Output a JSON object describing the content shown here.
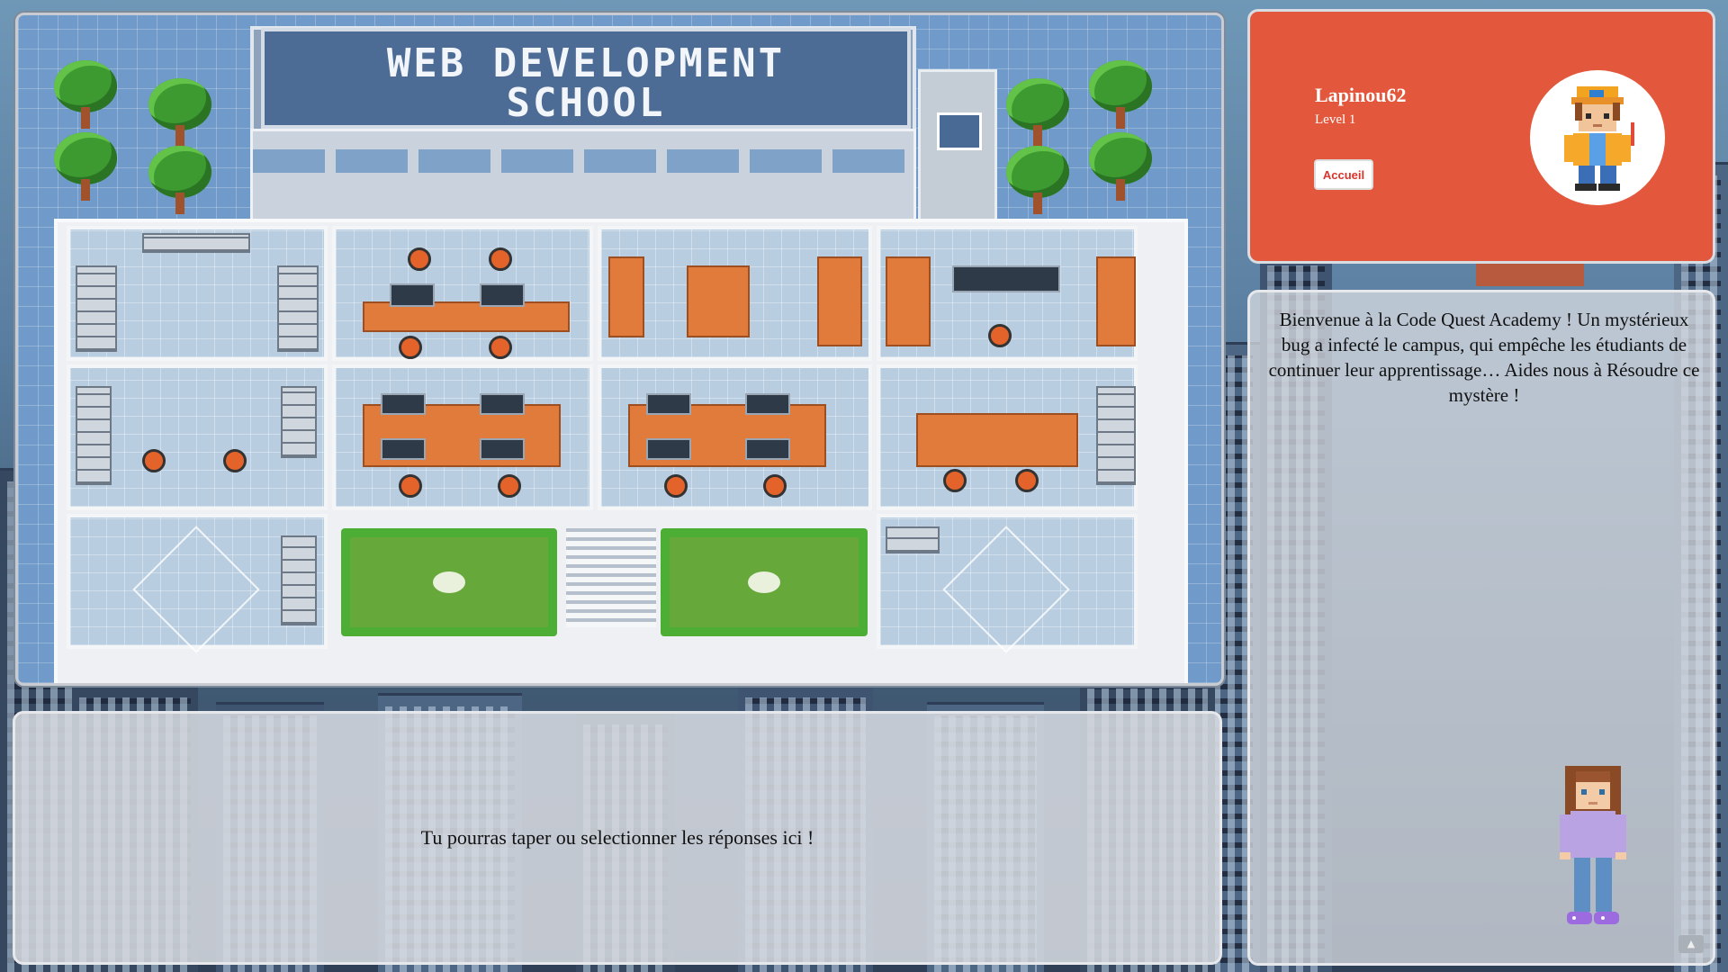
{
  "map": {
    "sign_line1": "WEB DEVELOPMENT",
    "sign_line2": "SCHOOL"
  },
  "profile": {
    "username": "Lapinou62",
    "level": "Level 1",
    "home_button": "Accueil",
    "avatar_icon": "pixel-boy-avatar-icon"
  },
  "story": {
    "text": "Bienvenue à la Code Quest Academy ! Un mystérieux bug a infecté le campus, qui empêche les étudiants de continuer leur apprentissage… Aides nous à Résoudre ce mystère !",
    "character_icon": "pixel-girl-character-icon"
  },
  "answer": {
    "hint": "Tu pourras taper ou selectionner les réponses ici !"
  },
  "colors": {
    "profile_bg": "#e3573c",
    "button_text": "#d9342b"
  }
}
